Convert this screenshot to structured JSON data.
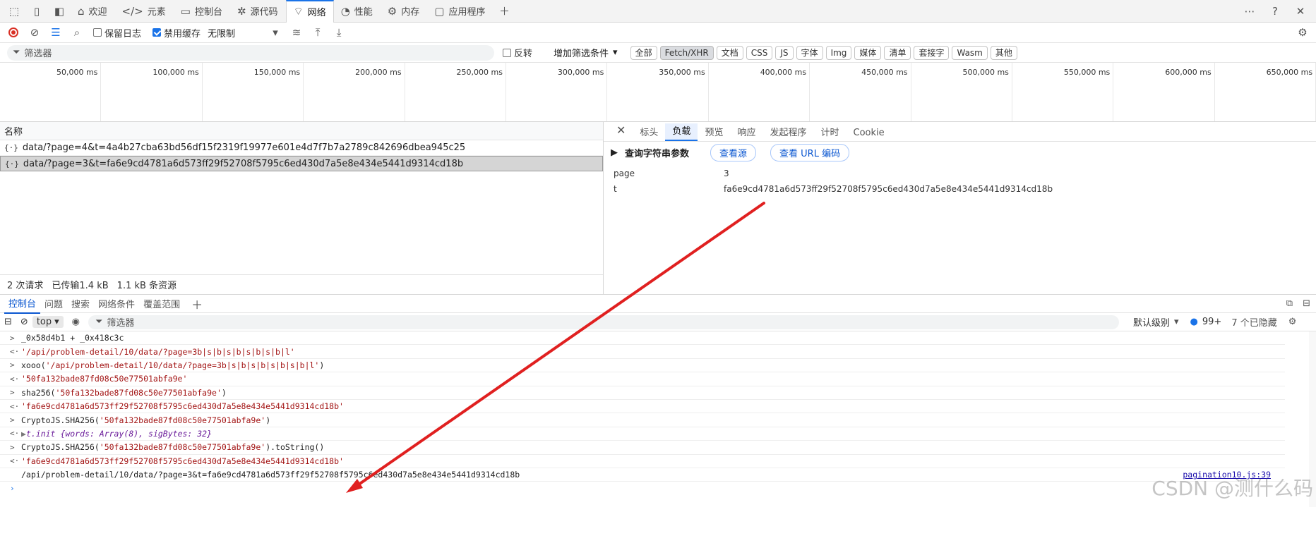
{
  "tabs": [
    {
      "icon": "home-icon",
      "label": "欢迎"
    },
    {
      "icon": "code-icon",
      "label": "元素"
    },
    {
      "icon": "console-icon",
      "label": "控制台"
    },
    {
      "icon": "bug-icon",
      "label": "源代码"
    },
    {
      "icon": "wifi-icon",
      "label": "网络"
    },
    {
      "icon": "performance-icon",
      "label": "性能"
    },
    {
      "icon": "memory-icon",
      "label": "内存"
    },
    {
      "icon": "application-icon",
      "label": "应用程序"
    }
  ],
  "net": {
    "preserve_log": "保留日志",
    "disable_cache": "禁用缓存",
    "throttle": "无限制"
  },
  "filter": {
    "placeholder": "筛选器",
    "invert": "反转",
    "more_filters": "增加筛选条件",
    "types": [
      "全部",
      "Fetch/XHR",
      "文档",
      "CSS",
      "JS",
      "字体",
      "Img",
      "媒体",
      "清单",
      "套接字",
      "Wasm",
      "其他"
    ],
    "selected": "Fetch/XHR"
  },
  "timeline": {
    "ticks": [
      "50,000 ms",
      "100,000 ms",
      "150,000 ms",
      "200,000 ms",
      "250,000 ms",
      "300,000 ms",
      "350,000 ms",
      "400,000 ms",
      "450,000 ms",
      "500,000 ms",
      "550,000 ms",
      "600,000 ms",
      "650,000 ms"
    ]
  },
  "reqlist": {
    "header": "名称",
    "rows": [
      "data/?page=4&t=4a4b27cba63bd56df15f2319f19977e601e4d7f7b7a2789c842696dbea945c25",
      "data/?page=3&t=fa6e9cd4781a6d573ff29f52708f5795c6ed430d7a5e8e434e5441d9314cd18b"
    ],
    "summary": {
      "requests": "2 次请求",
      "transferred": "已传输1.4 kB",
      "resources": "1.1 kB 条资源"
    }
  },
  "detail": {
    "tabs": [
      "标头",
      "负载",
      "预览",
      "响应",
      "发起程序",
      "计时",
      "Cookie"
    ],
    "active": "负载",
    "section": "查询字符串参数",
    "view_source": "查看源",
    "view_url_encoded": "查看 URL 编码",
    "params": [
      {
        "k": "page",
        "v": "3"
      },
      {
        "k": "t",
        "v": "fa6e9cd4781a6d573ff29f52708f5795c6ed430d7a5e8e434e5441d9314cd18b"
      }
    ]
  },
  "drawer": {
    "tabs": [
      "控制台",
      "问题",
      "搜索",
      "网络条件",
      "覆盖范围"
    ],
    "context": "top",
    "filter": "筛选器",
    "level": "默认级别",
    "issues": "99+",
    "hidden": "7 个已隐藏"
  },
  "console": {
    "lines": [
      {
        "a": ">",
        "parts": [
          {
            "c": "",
            "t": "_0x58d4b1 + _0x418c3c"
          }
        ]
      },
      {
        "a": "<·",
        "parts": [
          {
            "c": "str",
            "t": "'/api/problem-detail/10/data/?page=3b|s|b|s|b|s|b|s|b|l'"
          }
        ]
      },
      {
        "a": ">",
        "parts": [
          {
            "c": "",
            "t": "xooo("
          },
          {
            "c": "str",
            "t": "'/api/problem-detail/10/data/?page=3b|s|b|s|b|s|b|s|b|l'"
          },
          {
            "c": "",
            "t": ")"
          }
        ]
      },
      {
        "a": "<·",
        "parts": [
          {
            "c": "str",
            "t": "'50fa132bade87fd08c50e77501abfa9e'"
          }
        ]
      },
      {
        "a": ">",
        "parts": [
          {
            "c": "",
            "t": "sha256("
          },
          {
            "c": "str",
            "t": "'50fa132bade87fd08c50e77501abfa9e'"
          },
          {
            "c": "",
            "t": ")"
          }
        ]
      },
      {
        "a": "<·",
        "parts": [
          {
            "c": "str",
            "t": "'fa6e9cd4781a6d573ff29f52708f5795c6ed430d7a5e8e434e5441d9314cd18b'"
          }
        ]
      },
      {
        "a": ">",
        "parts": [
          {
            "c": "",
            "t": "CryptoJS.SHA256("
          },
          {
            "c": "str",
            "t": "'50fa132bade87fd08c50e77501abfa9e'"
          },
          {
            "c": "",
            "t": ")"
          }
        ]
      },
      {
        "a": "<·",
        "parts": [
          {
            "c": "dim",
            "t": "▶ "
          },
          {
            "c": "ital",
            "t": "t.init {words: Array(8), sigBytes: 32}"
          }
        ]
      },
      {
        "a": ">",
        "parts": [
          {
            "c": "",
            "t": "CryptoJS.SHA256("
          },
          {
            "c": "str",
            "t": "'50fa132bade87fd08c50e77501abfa9e'"
          },
          {
            "c": "",
            "t": ").toString()"
          }
        ]
      },
      {
        "a": "<·",
        "parts": [
          {
            "c": "str",
            "t": "'fa6e9cd4781a6d573ff29f52708f5795c6ed430d7a5e8e434e5441d9314cd18b'"
          }
        ]
      },
      {
        "a": "",
        "parts": [
          {
            "c": "",
            "t": "/api/problem-detail/10/data/?page=3&t=fa6e9cd4781a6d573ff29f52708f5795c6ed430d7a5e8e434e5441d9314cd18b"
          }
        ],
        "src": "pagination10.js:39"
      }
    ]
  },
  "watermark": "CSDN @测什么码"
}
